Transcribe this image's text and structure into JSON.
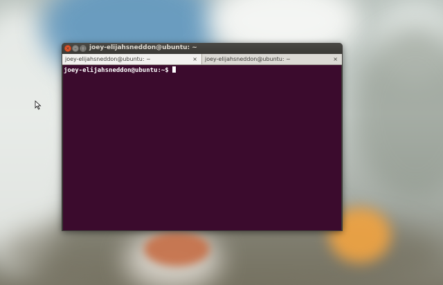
{
  "window": {
    "title": "joey-elijahsneddon@ubuntu: ~",
    "close_glyph": "×",
    "minimize_glyph": "–",
    "maximize_glyph": "□"
  },
  "tabs": [
    {
      "label": "joey-elijahsneddon@ubuntu: ~",
      "close": "×",
      "active": true
    },
    {
      "label": "joey-elijahsneddon@ubuntu: ~",
      "close": "×",
      "active": false
    }
  ],
  "terminal": {
    "prompt": "joey-elijahsneddon@ubuntu:~$",
    "background_color": "#3b0b2d",
    "text_color": "#ffffff"
  },
  "colors": {
    "titlebar": "#3c3b37",
    "close_button": "#e2552b",
    "tab_active": "#f2f1ef"
  },
  "icons": {
    "mouse_pointer": "arrow-cursor-icon"
  }
}
